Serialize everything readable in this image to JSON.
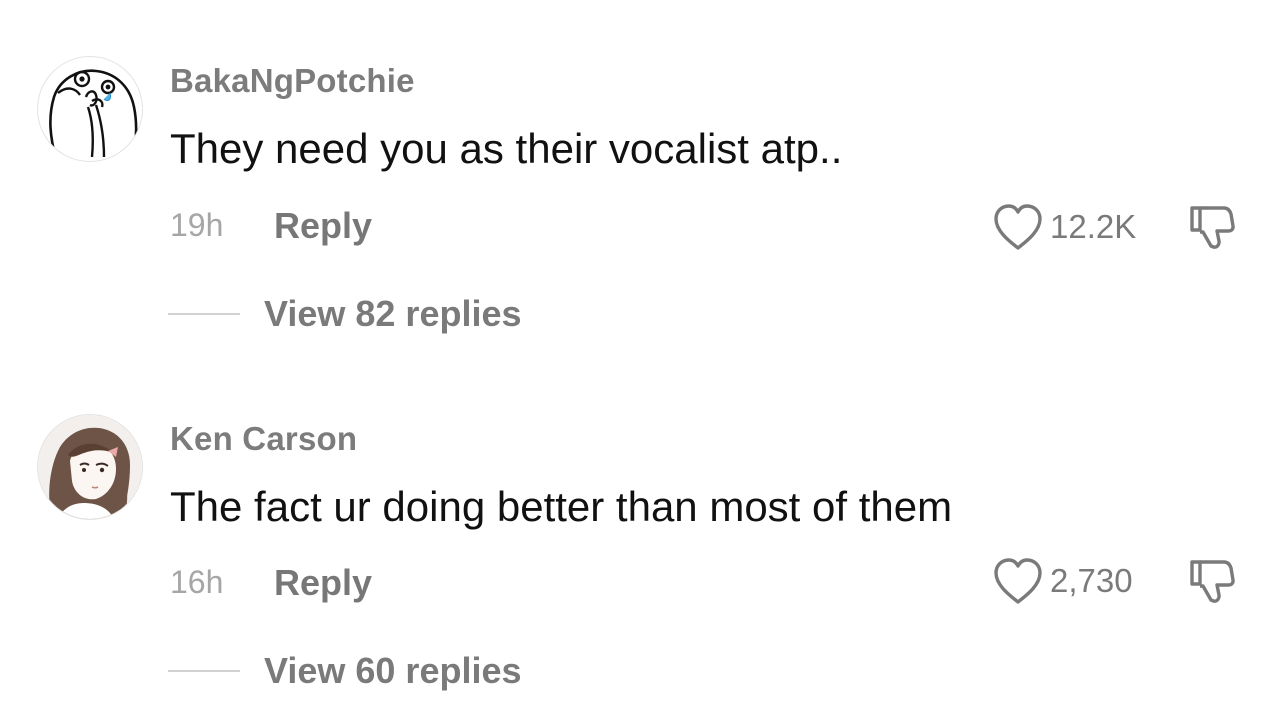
{
  "comments": [
    {
      "avatar_icon": "crying-meme-face-avatar",
      "username": "BakaNgPotchie",
      "text": "They need you as their vocalist atp..",
      "time": "19h",
      "reply_label": "Reply",
      "like_icon": "heart-outline-icon",
      "likes": "12.2K",
      "dislike_icon": "thumbs-down-icon",
      "view_replies_label": "View 82 replies"
    },
    {
      "avatar_icon": "anime-girl-sketch-avatar",
      "username": "Ken Carson",
      "text": "The fact ur doing better than most of them",
      "time": "16h",
      "reply_label": "Reply",
      "like_icon": "heart-outline-icon",
      "likes": "2,730",
      "dislike_icon": "thumbs-down-icon",
      "view_replies_label": "View 60 replies"
    }
  ],
  "colors": {
    "username": "#7c7c7c",
    "text": "#111111",
    "meta": "#a6a6a6",
    "action": "#777777",
    "divider": "#d2d2d2"
  }
}
